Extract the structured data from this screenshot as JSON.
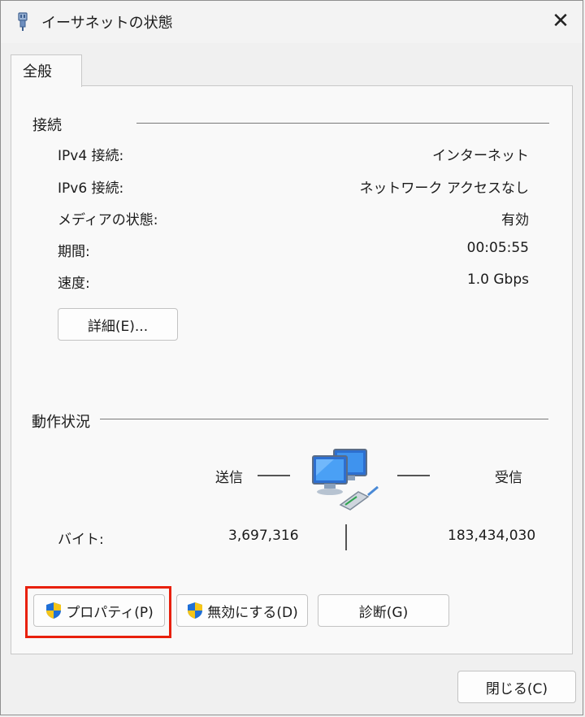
{
  "window": {
    "title": "イーサネットの状態",
    "close_glyph": "✕"
  },
  "tabs": [
    {
      "label": "全般"
    }
  ],
  "connection": {
    "group_title": "接続",
    "rows": [
      {
        "label": "IPv4 接続:",
        "value": "インターネット"
      },
      {
        "label": "IPv6 接続:",
        "value": "ネットワーク アクセスなし"
      },
      {
        "label": "メディアの状態:",
        "value": "有効"
      },
      {
        "label": "期間:",
        "value": "00:05:55"
      },
      {
        "label": "速度:",
        "value": "1.0 Gbps"
      }
    ],
    "details_button": "詳細(E)..."
  },
  "activity": {
    "group_title": "動作状況",
    "sent_label": "送信",
    "received_label": "受信",
    "bytes_label": "バイト:",
    "bytes_sent": "3,697,316",
    "bytes_received": "183,434,030",
    "icon": "network-computers-icon"
  },
  "buttons": {
    "properties": "プロパティ(P)",
    "disable": "無効にする(D)",
    "diagnose": "診断(G)",
    "close": "閉じる(C)"
  },
  "colors": {
    "highlight": "#e8200c",
    "shield_blue": "#1f6fd6",
    "shield_yellow": "#f5c518"
  }
}
